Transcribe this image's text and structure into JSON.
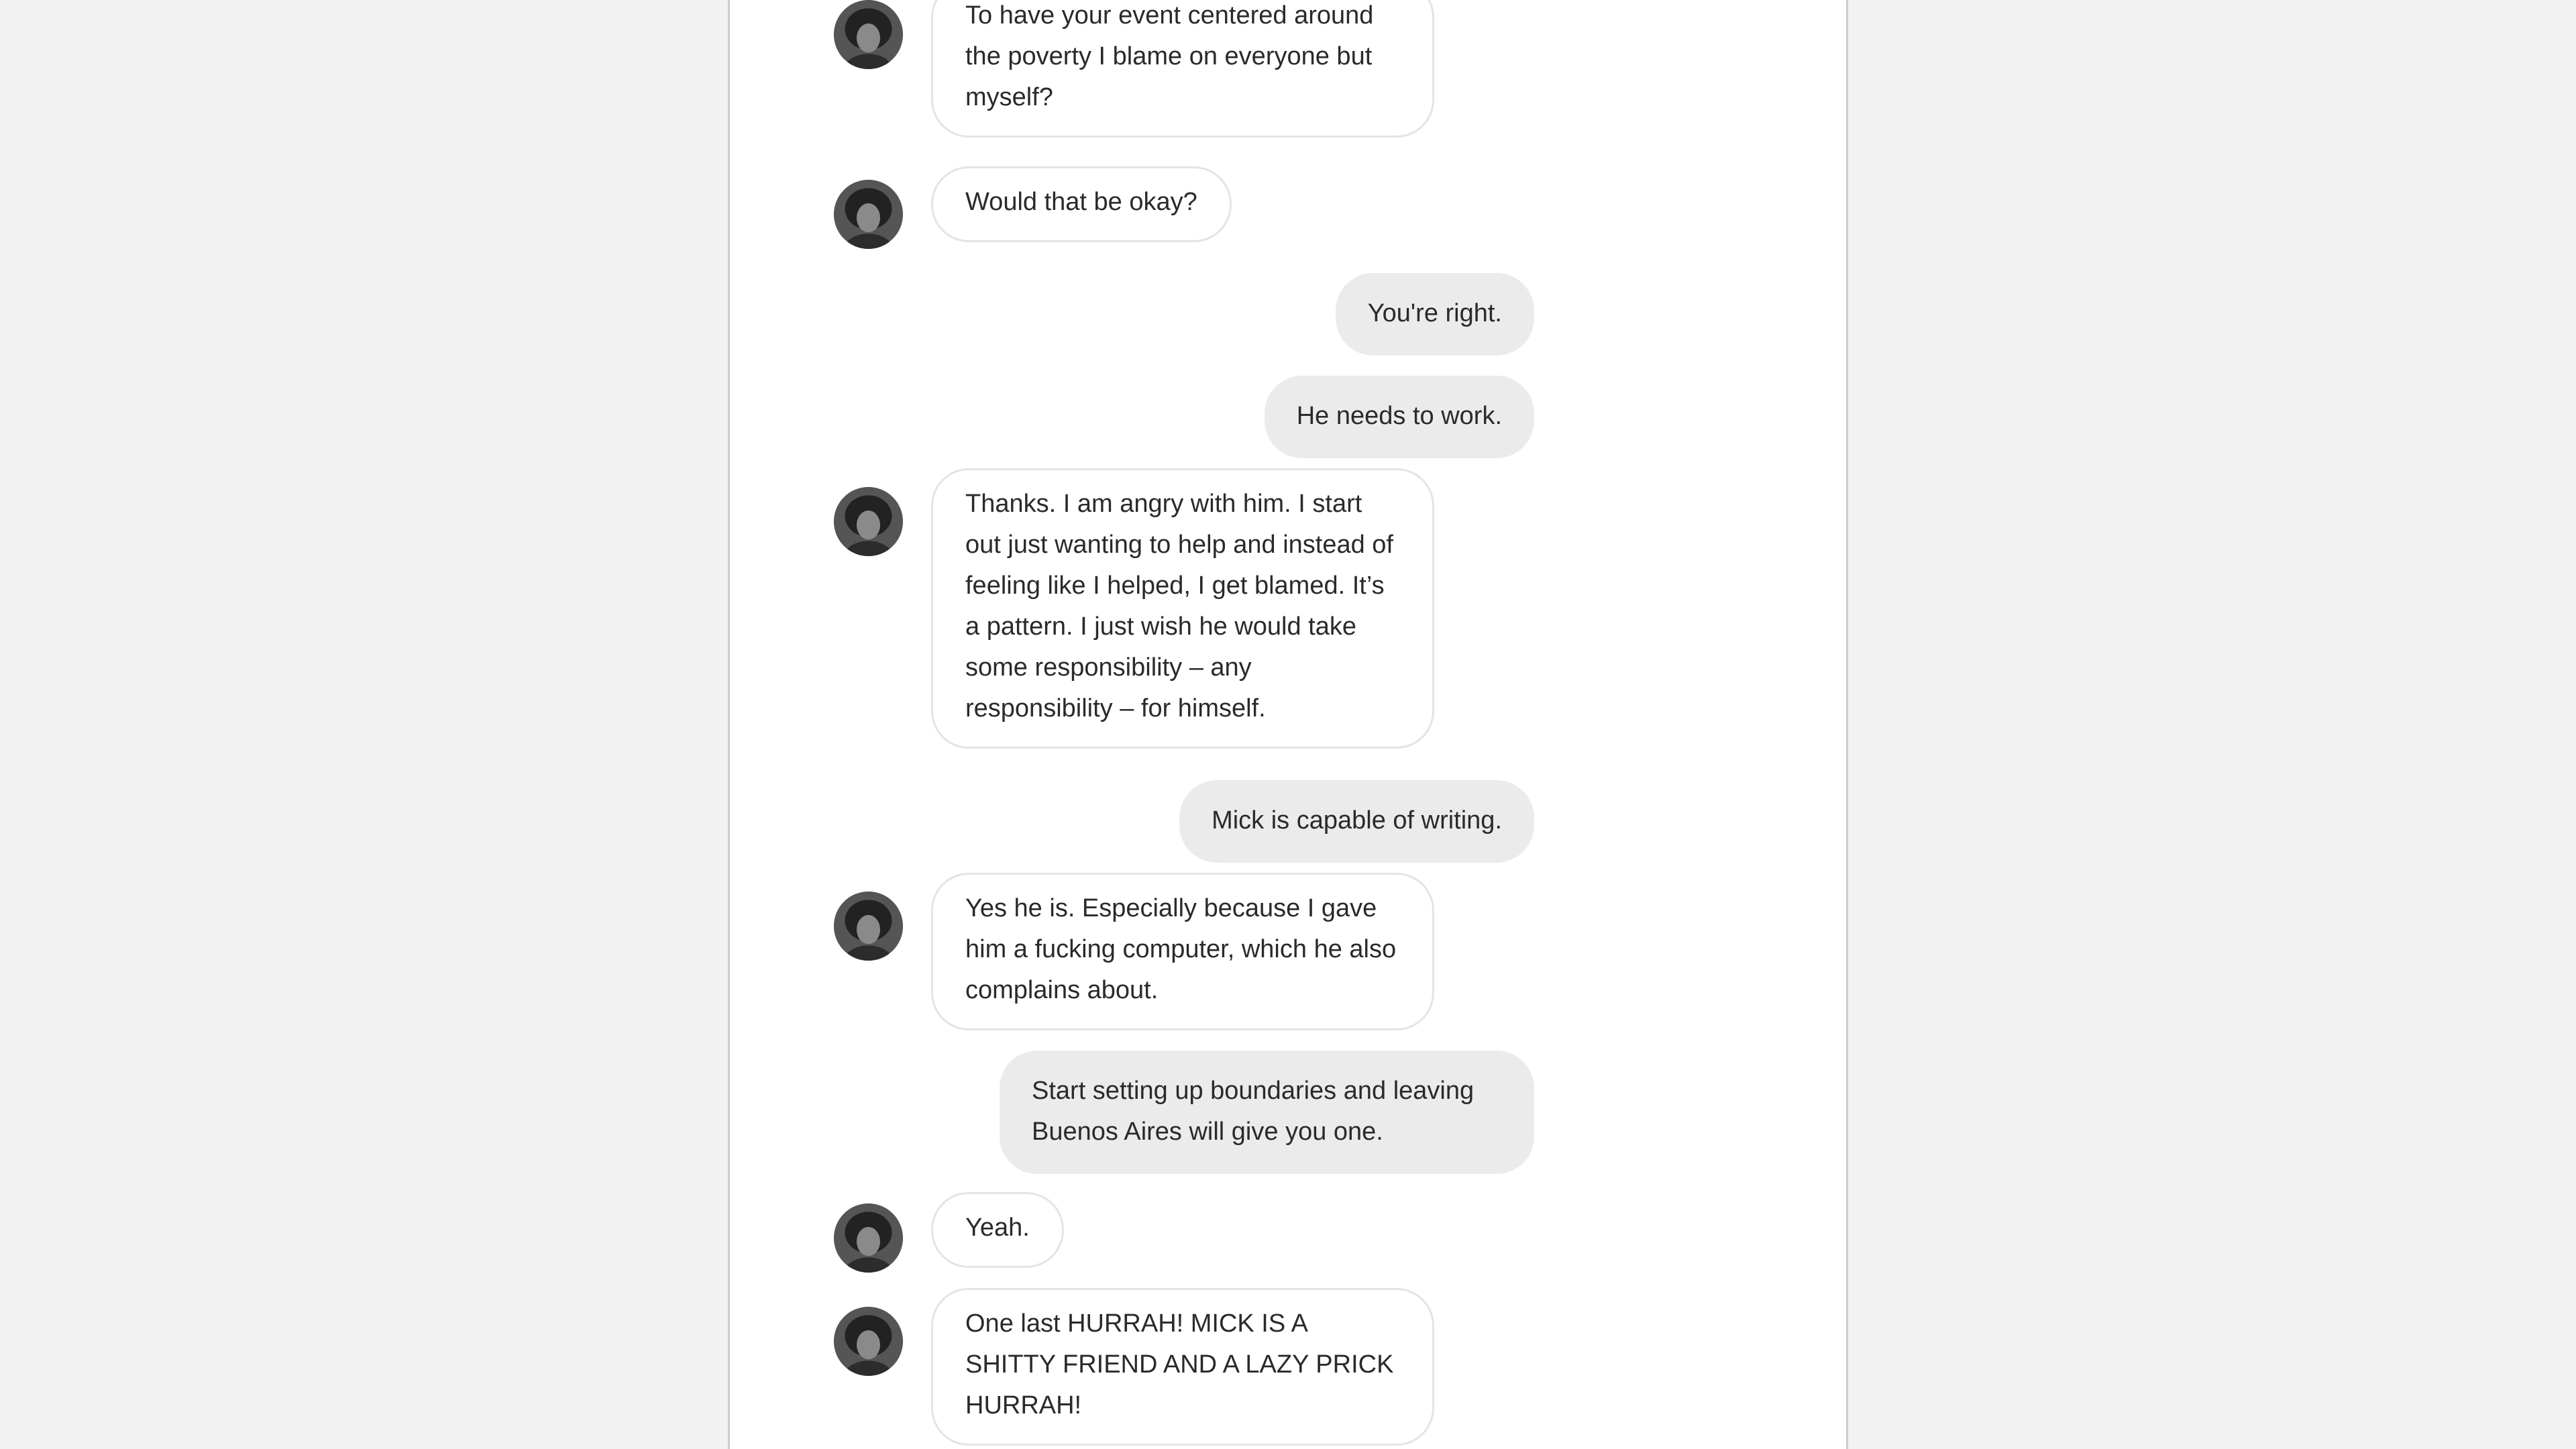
{
  "messages": [
    {
      "sender": "contact",
      "text": "To have your event centered around the poverty I blame on everyone but myself?"
    },
    {
      "sender": "contact",
      "text": "Would that be okay?"
    },
    {
      "sender": "user",
      "text": "You're right."
    },
    {
      "sender": "user",
      "text": "He needs to work."
    },
    {
      "sender": "contact",
      "text": "Thanks. I am angry with him. I start out just wanting to help and instead of feeling like I helped, I get blamed. It’s a pattern. I just wish he would take some responsibility – any responsibility – for himself."
    },
    {
      "sender": "user",
      "text": "Mick is capable of writing."
    },
    {
      "sender": "contact",
      "text": "Yes he is. Especially because I gave him a fucking computer, which he also complains about."
    },
    {
      "sender": "user",
      "text": "Start setting up boundaries and leaving Buenos Aires will give you one."
    },
    {
      "sender": "contact",
      "text": "Yeah."
    },
    {
      "sender": "contact",
      "text": "One last HURRAH! MICK IS A SHITTY FRIEND AND A LAZY PRICK HURRAH!"
    }
  ],
  "colors": {
    "page_background": "#f2f2f2",
    "column_background": "#ffffff",
    "incoming_bubble": "#ffffff",
    "incoming_border": "#e4e4e4",
    "outgoing_bubble": "#ebebeb",
    "text": "#2a2a2a"
  },
  "icons": {
    "avatar": "contact-avatar-icon"
  }
}
